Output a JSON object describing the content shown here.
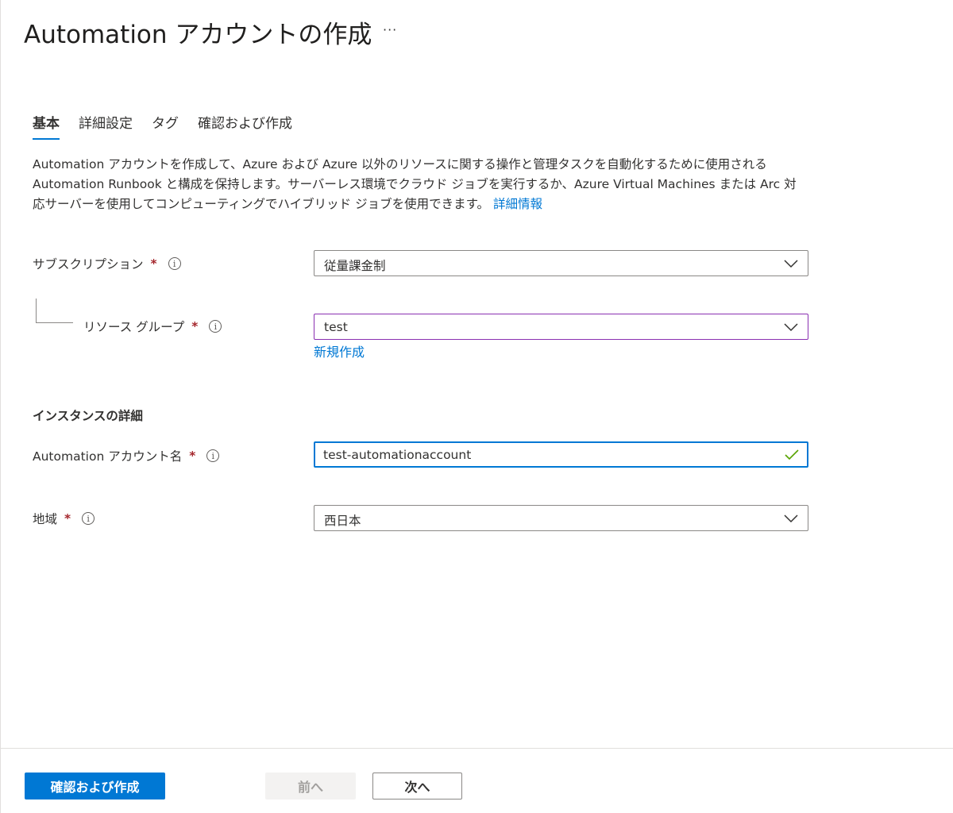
{
  "header": {
    "title": "Automation アカウントの作成",
    "more_label": "···"
  },
  "tabs": [
    {
      "label": "基本",
      "active": true
    },
    {
      "label": "詳細設定",
      "active": false
    },
    {
      "label": "タグ",
      "active": false
    },
    {
      "label": "確認および作成",
      "active": false
    }
  ],
  "description": {
    "line1": "Automation アカウントを作成して、Azure および Azure 以外のリソースに関する操作と管理タスクを自動化するために使用される",
    "line2": "Automation Runbook と構成を保持します。サーバーレス環境でクラウド ジョブを実行するか、Azure Virtual Machines または Arc 対",
    "line3": "応サーバーを使用してコンピューティングでハイブリッド ジョブを使用できます。",
    "link": "詳細情報"
  },
  "form": {
    "subscription": {
      "label": "サブスクリプション",
      "required": "*",
      "value": "従量課金制"
    },
    "resource_group": {
      "label": "リソース グループ",
      "required": "*",
      "value": "test",
      "create_new": "新規作成"
    },
    "instance_heading": "インスタンスの詳細",
    "account_name": {
      "label": "Automation アカウント名",
      "required": "*",
      "value": "test-automationaccount"
    },
    "region": {
      "label": "地域",
      "required": "*",
      "value": "西日本"
    }
  },
  "footer": {
    "review_create": "確認および作成",
    "previous": "前へ",
    "next": "次へ"
  },
  "colors": {
    "accent": "#0078d4",
    "required": "#a4262c",
    "focus": "#8a2fb1",
    "valid": "#57a300"
  },
  "icons": {
    "info": "info-icon",
    "chevron": "chevron-down-icon",
    "valid": "checkmark-icon"
  }
}
